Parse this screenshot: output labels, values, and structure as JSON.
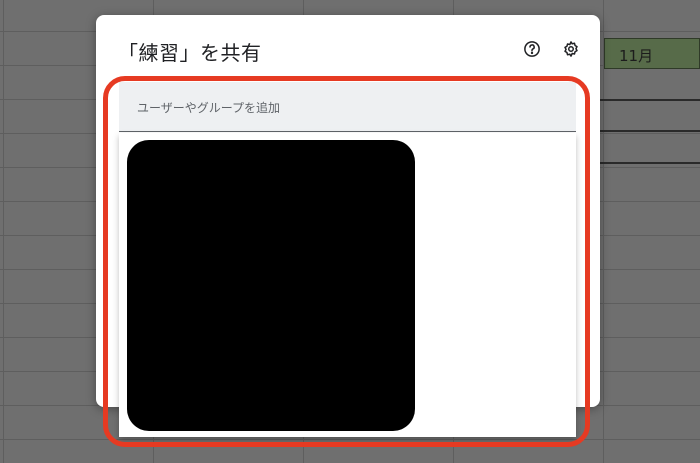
{
  "background_sheet": {
    "selected_cell_text": "11月"
  },
  "dialog": {
    "title": "「練習」を共有",
    "help_icon": "help-circle-icon",
    "settings_icon": "gear-icon",
    "people_field": {
      "placeholder": "ユーザーやグループを追加"
    }
  },
  "colors": {
    "highlight_border": "#e63a22",
    "dialog_bg": "#ffffff",
    "field_bg": "#eef0f2",
    "cell_fill": "#576b49"
  }
}
